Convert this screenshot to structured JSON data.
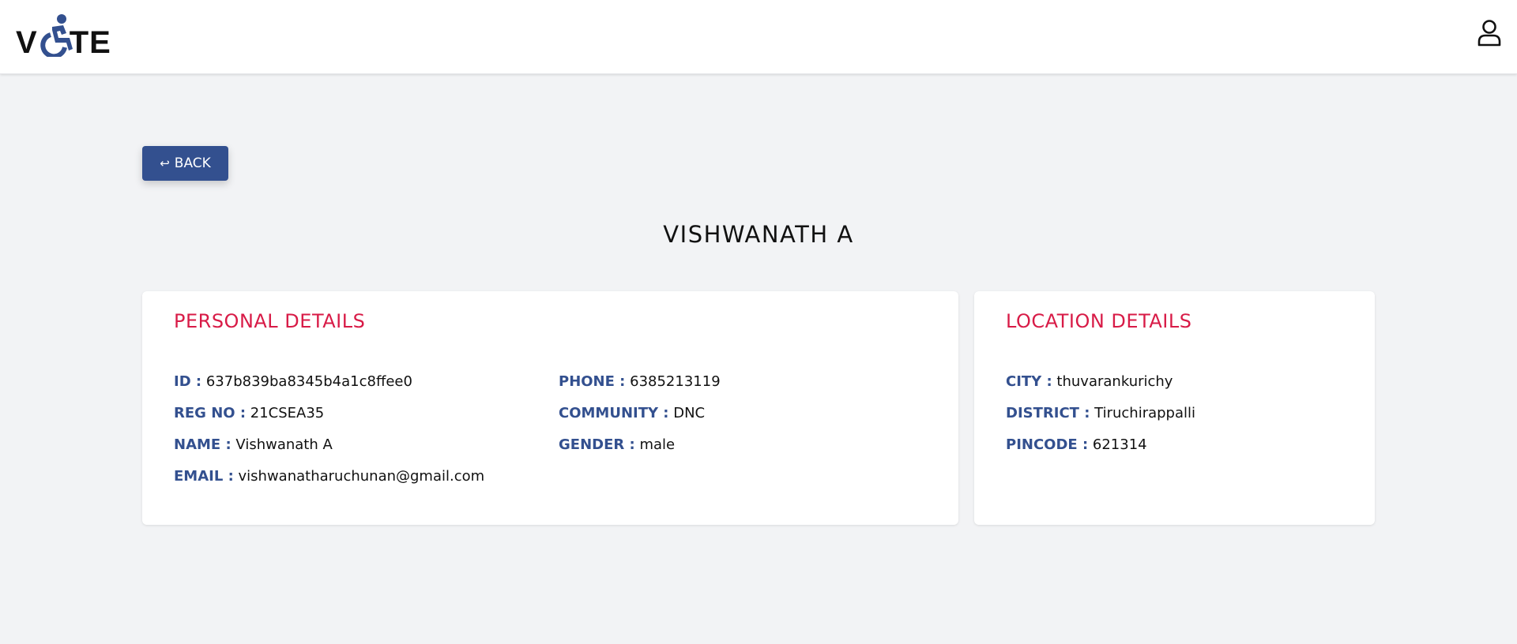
{
  "header": {
    "logo_text_before": "V",
    "logo_text_after": "TE",
    "logo_accent_color": "#33508f",
    "profile_icon": "user-icon"
  },
  "back_button": {
    "icon": "return-arrow-icon",
    "label": "BACK"
  },
  "voter_name": "VISHWANATH A",
  "personal_details": {
    "title": "PERSONAL DETAILS",
    "fields": {
      "id": {
        "label": "ID :",
        "value": "637b839ba8345b4a1c8ffee0"
      },
      "reg_no": {
        "label": "REG NO :",
        "value": "21CSEA35"
      },
      "name": {
        "label": "NAME :",
        "value": "Vishwanath A"
      },
      "email": {
        "label": "EMAIL :",
        "value": "vishwanatharuchunan@gmail.com"
      },
      "phone": {
        "label": "PHONE :",
        "value": "6385213119"
      },
      "community": {
        "label": "COMMUNITY :",
        "value": "DNC"
      },
      "gender": {
        "label": "GENDER :",
        "value": "male"
      }
    }
  },
  "location_details": {
    "title": "LOCATION DETAILS",
    "fields": {
      "city": {
        "label": "CITY :",
        "value": "thuvarankurichy"
      },
      "district": {
        "label": "DISTRICT :",
        "value": "Tiruchirappalli"
      },
      "pincode": {
        "label": "PINCODE :",
        "value": "621314"
      }
    }
  },
  "colors": {
    "primary": "#33508f",
    "heading_red": "#d81b47",
    "page_bg": "#f2f3f5"
  }
}
